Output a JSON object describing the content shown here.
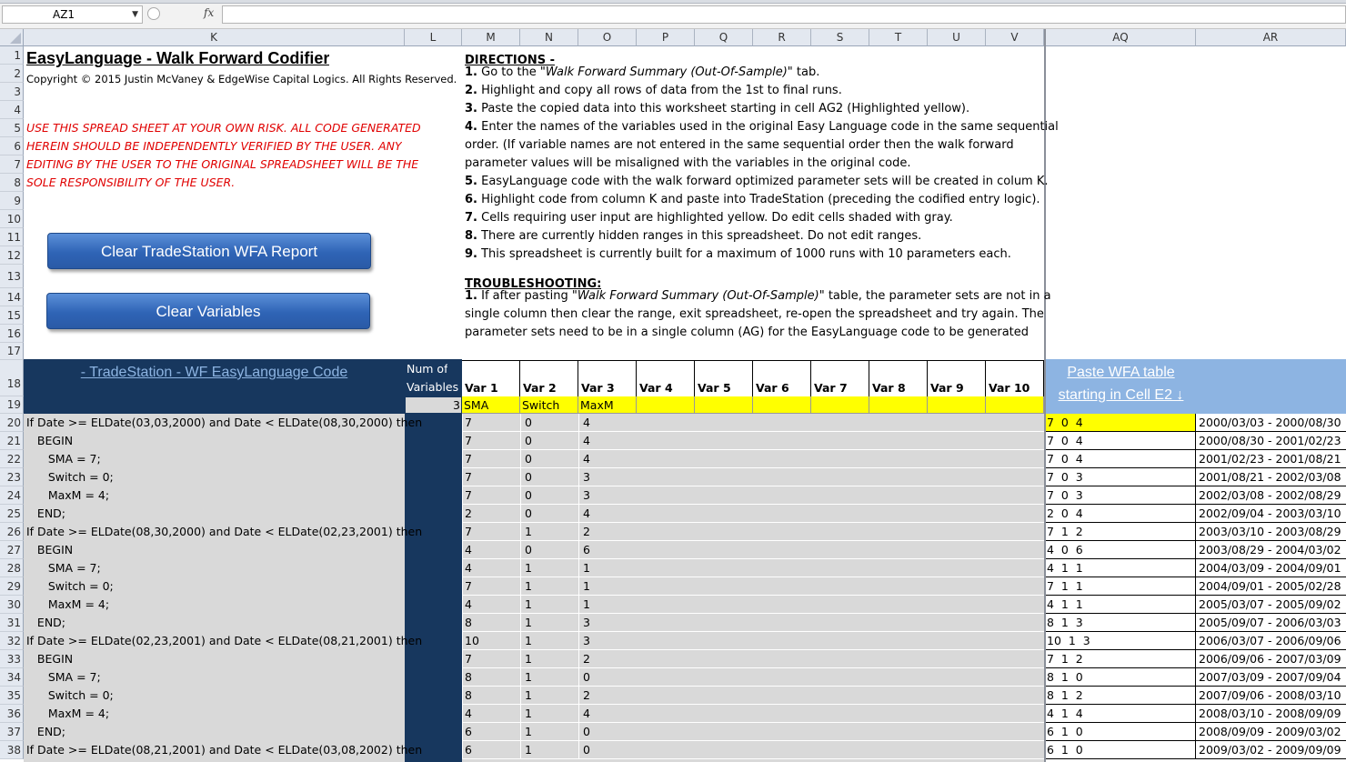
{
  "formula_bar": {
    "name_box": "AZ1",
    "fx": "fx",
    "formula": ""
  },
  "columns": [
    "K",
    "L",
    "M",
    "N",
    "O",
    "P",
    "Q",
    "R",
    "S",
    "T",
    "U",
    "V",
    "AQ",
    "AR"
  ],
  "row_numbers": [
    "1",
    "2",
    "3",
    "4",
    "5",
    "6",
    "7",
    "8",
    "9",
    "10",
    "11",
    "12",
    "13",
    "14",
    "15",
    "16",
    "17",
    "18",
    "19",
    "20",
    "21",
    "22",
    "23",
    "24",
    "25",
    "26",
    "27",
    "28",
    "29",
    "30",
    "31",
    "32",
    "33",
    "34",
    "35",
    "36",
    "37",
    "38"
  ],
  "title": "EasyLanguage - Walk Forward Codifier",
  "copyright": "Copyright © 2015 Justin McVaney & EdgeWise Capital Logics. All Rights Reserved.",
  "warning": [
    "USE THIS SPREAD SHEET AT YOUR OWN RISK. ALL CODE GENERATED",
    "HEREIN SHOULD BE INDEPENDENTLY VERIFIED BY THE USER. ANY",
    "EDITING BY THE USER TO THE ORIGINAL SPREADSHEET WILL BE THE",
    "SOLE RESPONSIBILITY OF THE USER."
  ],
  "buttons": {
    "clear_report": "Clear TradeStation WFA Report",
    "clear_vars": "Clear Variables"
  },
  "directions_title": "DIRECTIONS -",
  "directions": [
    {
      "num": "1.",
      "pre": " Go to the \"",
      "em": "Walk Forward Summary (Out-Of-Sample)",
      "post": "\" tab."
    },
    {
      "num": "2.",
      "pre": " Highlight and copy all rows of data from the 1st to final runs.",
      "em": "",
      "post": ""
    },
    {
      "num": "3.",
      "pre": " Paste the copied data into this worksheet starting in cell AG2 (Highlighted yellow).",
      "em": "",
      "post": ""
    },
    {
      "num": "4.",
      "pre": " Enter the names of the variables used in the original Easy Language code in the same sequential",
      "em": "",
      "post": ""
    },
    {
      "num": "",
      "pre": "order. (If variable names are not entered in the same sequential order then the walk forward",
      "em": "",
      "post": ""
    },
    {
      "num": "",
      "pre": "parameter values will be misaligned with the variables in the original code.",
      "em": "",
      "post": ""
    },
    {
      "num": "5.",
      "pre": " EasyLanguage code with the walk forward optimized parameter sets will be created in colum K.",
      "em": "",
      "post": ""
    },
    {
      "num": "6.",
      "pre": " Highlight code from column K and paste into TradeStation (preceding the codified entry logic).",
      "em": "",
      "post": ""
    },
    {
      "num": "7.",
      "pre": " Cells requiring user input are highlighted yellow. Do edit cells shaded with gray.",
      "em": "",
      "post": ""
    },
    {
      "num": "8.",
      "pre": " There are currently hidden ranges in this spreadsheet. Do not edit ranges.",
      "em": "",
      "post": ""
    },
    {
      "num": "9.",
      "pre": " This spreadsheet is currently built for a maximum of 1000 runs with 10 parameters each.",
      "em": "",
      "post": ""
    }
  ],
  "troubleshooting_title": "TROUBLESHOOTING:",
  "troubleshooting": [
    {
      "num": "1.",
      "pre": " If after pasting  \"",
      "em": "Walk Forward Summary (Out-Of-Sample)",
      "post": "\" table, the parameter sets are not in a"
    },
    {
      "num": "",
      "pre": "single column then clear the range, exit spreadsheet, re-open the spreadsheet and try again. The",
      "em": "",
      "post": ""
    },
    {
      "num": "",
      "pre": "parameter sets need to be in a single column (AG) for the EasyLanguage code to be generated",
      "em": "",
      "post": ""
    }
  ],
  "table": {
    "code_header": "- TradeStation - WF EasyLanguage Code",
    "num_of": "Num of",
    "variables_label": "Variables",
    "num_vars": "3",
    "var_headers": [
      "Var 1",
      "Var 2",
      "Var 3",
      "Var 4",
      "Var 5",
      "Var 6",
      "Var 7",
      "Var 8",
      "Var 9",
      "Var 10"
    ],
    "var_names": [
      "SMA",
      "Switch",
      "MaxM",
      "",
      "",
      "",
      "",
      "",
      "",
      ""
    ],
    "paste_header": [
      "Paste WFA table",
      "starting in Cell E2 ↓"
    ],
    "rows": [
      {
        "code": "If Date >= ELDate(03,03,2000) and Date < ELDate(08,30,2000) then",
        "v": [
          "7",
          "0",
          "4"
        ],
        "aq": "7  0  4",
        "ar": "2000/03/03 - 2000/08/30"
      },
      {
        "code": "   BEGIN",
        "v": [
          "7",
          "0",
          "4"
        ],
        "aq": "7  0  4",
        "ar": "2000/08/30 - 2001/02/23"
      },
      {
        "code": "      SMA = 7;",
        "v": [
          "7",
          "0",
          "4"
        ],
        "aq": "7  0  4",
        "ar": "2001/02/23 - 2001/08/21"
      },
      {
        "code": "      Switch = 0;",
        "v": [
          "7",
          "0",
          "3"
        ],
        "aq": "7  0  3",
        "ar": "2001/08/21 - 2002/03/08"
      },
      {
        "code": "      MaxM = 4;",
        "v": [
          "7",
          "0",
          "3"
        ],
        "aq": "7  0  3",
        "ar": "2002/03/08 - 2002/08/29"
      },
      {
        "code": "   END;",
        "v": [
          "2",
          "0",
          "4"
        ],
        "aq": "2  0  4",
        "ar": "2002/09/04 - 2003/03/10"
      },
      {
        "code": "If Date >= ELDate(08,30,2000) and Date < ELDate(02,23,2001) then",
        "v": [
          "7",
          "1",
          "2"
        ],
        "aq": "7  1  2",
        "ar": "2003/03/10 - 2003/08/29"
      },
      {
        "code": "   BEGIN",
        "v": [
          "4",
          "0",
          "6"
        ],
        "aq": "4  0  6",
        "ar": "2003/08/29 - 2004/03/02"
      },
      {
        "code": "      SMA = 7;",
        "v": [
          "4",
          "1",
          "1"
        ],
        "aq": "4  1  1",
        "ar": "2004/03/09 - 2004/09/01"
      },
      {
        "code": "      Switch = 0;",
        "v": [
          "7",
          "1",
          "1"
        ],
        "aq": "7  1  1",
        "ar": "2004/09/01 - 2005/02/28"
      },
      {
        "code": "      MaxM = 4;",
        "v": [
          "4",
          "1",
          "1"
        ],
        "aq": "4  1  1",
        "ar": "2005/03/07 - 2005/09/02"
      },
      {
        "code": "   END;",
        "v": [
          "8",
          "1",
          "3"
        ],
        "aq": "8  1  3",
        "ar": "2005/09/07 - 2006/03/03"
      },
      {
        "code": "If Date >= ELDate(02,23,2001) and Date < ELDate(08,21,2001) then",
        "v": [
          "10",
          "1",
          "3"
        ],
        "aq": "10  1  3",
        "ar": "2006/03/07 - 2006/09/06"
      },
      {
        "code": "   BEGIN",
        "v": [
          "7",
          "1",
          "2"
        ],
        "aq": "7  1  2",
        "ar": "2006/09/06 - 2007/03/09"
      },
      {
        "code": "      SMA = 7;",
        "v": [
          "8",
          "1",
          "0"
        ],
        "aq": "8  1  0",
        "ar": "2007/03/09 - 2007/09/04"
      },
      {
        "code": "      Switch = 0;",
        "v": [
          "8",
          "1",
          "2"
        ],
        "aq": "8  1  2",
        "ar": "2007/09/06 - 2008/03/10"
      },
      {
        "code": "      MaxM = 4;",
        "v": [
          "4",
          "1",
          "4"
        ],
        "aq": "4  1  4",
        "ar": "2008/03/10 - 2008/09/09"
      },
      {
        "code": "   END;",
        "v": [
          "6",
          "1",
          "0"
        ],
        "aq": "6  1  0",
        "ar": "2008/09/09 - 2009/03/02"
      },
      {
        "code": "If Date >= ELDate(08,21,2001) and Date < ELDate(03,08,2002) then",
        "v": [
          "6",
          "1",
          "0"
        ],
        "aq": "6  1  0",
        "ar": "2009/03/02 - 2009/09/09"
      }
    ]
  }
}
